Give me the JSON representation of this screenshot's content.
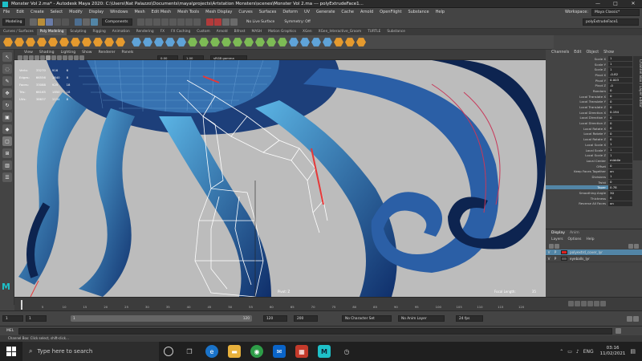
{
  "window": {
    "title": "Monster Vol 2.ma* - Autodesk Maya 2020: C:\\Users\\Nat Palazzo\\Documents\\maya\\projects\\Artstation Monsters\\scenes\\Monster Vol 2.ma  ---  polyExtrudeFace1...",
    "minimize": "—",
    "maximize": "□",
    "close": "✕"
  },
  "menubar": [
    "File",
    "Edit",
    "Create",
    "Select",
    "Modify",
    "Display",
    "Windows",
    "Mesh",
    "Edit Mesh",
    "Mesh Tools",
    "Mesh Display",
    "Curves",
    "Surfaces",
    "Deform",
    "UV",
    "Generate",
    "Cache",
    "Arnold",
    "OpenFlight",
    "Substance",
    "Help"
  ],
  "workspace": {
    "label": "Workspace:",
    "value": "Maya Classic*"
  },
  "statusline": {
    "mode": "Modeling",
    "components": "Components",
    "no_live_surface": "No Live Surface",
    "symmetry": "Symmetry: Off",
    "node_field": "polyExtrudeFace1"
  },
  "shelf_tabs": [
    "Curves / Surfaces",
    "Poly Modeling",
    "Sculpting",
    "Rigging",
    "Animation",
    "Rendering",
    "FX",
    "FX Caching",
    "Custom",
    "Arnold",
    "Bifrost",
    "MASH",
    "Motion Graphics",
    "XGen",
    "XGen_Interactive_Groom",
    "TURTLE",
    "Substance"
  ],
  "shelf_active": "Poly Modeling",
  "panel_menu": [
    "View",
    "Shading",
    "Lighting",
    "Show",
    "Renderer",
    "Panels"
  ],
  "panel_fields": {
    "a": "0.00",
    "b": "1.00",
    "colorspace": "sRGB gamma"
  },
  "hud": {
    "rows": [
      {
        "label": "Verts:",
        "a": "33270",
        "b": "916",
        "c": "6"
      },
      {
        "label": "Edges:",
        "a": "66556",
        "b": "1840",
        "c": "8"
      },
      {
        "label": "Faces:",
        "a": "33088",
        "b": "925",
        "c": "18"
      },
      {
        "label": "Tris:",
        "a": "66165",
        "b": "1850",
        "c": "18"
      },
      {
        "label": "UVs:",
        "a": "38637",
        "b": "1134",
        "c": "8"
      }
    ],
    "focal_length_label": "Focal Length:",
    "focal_length_value": "35",
    "pivot_label": "Pivot: Z"
  },
  "channelbox": {
    "tabs": [
      "Channels",
      "Edit",
      "Object",
      "Show"
    ],
    "rows": [
      {
        "name": "Scale X",
        "value": "1"
      },
      {
        "name": "Scale Y",
        "value": "1"
      },
      {
        "name": "Scale Z",
        "value": "1"
      },
      {
        "name": "Pivot X",
        "value": "-0.82"
      },
      {
        "name": "Pivot Y",
        "value": "0.003"
      },
      {
        "name": "Pivot Z",
        "value": "-0"
      },
      {
        "name": "Random",
        "value": "0"
      },
      {
        "name": "Local Translate X",
        "value": "0"
      },
      {
        "name": "Local Translate Y",
        "value": "0"
      },
      {
        "name": "Local Translate Z",
        "value": "0"
      },
      {
        "name": "Local Direction X",
        "value": "0.194"
      },
      {
        "name": "Local Direction Y",
        "value": "0"
      },
      {
        "name": "Local Direction Z",
        "value": "0"
      },
      {
        "name": "Local Rotate X",
        "value": "0"
      },
      {
        "name": "Local Rotate Y",
        "value": "0"
      },
      {
        "name": "Local Rotate Z",
        "value": "0"
      },
      {
        "name": "Local Scale X",
        "value": "1"
      },
      {
        "name": "Local Scale Y",
        "value": "1"
      },
      {
        "name": "Local Scale Z",
        "value": "1"
      },
      {
        "name": "Local Center",
        "value": "middle"
      },
      {
        "name": "Offset",
        "value": "0"
      },
      {
        "name": "Keep Faces Together",
        "value": "on"
      },
      {
        "name": "Divisions",
        "value": "1"
      },
      {
        "name": "Twist",
        "value": "0"
      },
      {
        "name": "Taper",
        "value": "0.78"
      },
      {
        "name": "Smoothing Angle",
        "value": "30"
      },
      {
        "name": "Thickness",
        "value": "0"
      },
      {
        "name": "Reverse All Faces",
        "value": "on"
      }
    ],
    "selected": "Taper",
    "side_tab": "Channel Box / Layer Editor"
  },
  "layers": {
    "tabs": [
      "Display",
      "Anim"
    ],
    "menu": [
      "Layers",
      "Options",
      "Help"
    ],
    "items": [
      {
        "v": "V",
        "p": "P",
        "name": "polyextrd_cover_lyr",
        "color": "#d22"
      },
      {
        "v": "V",
        "p": "P",
        "name": "eyeballs_lyr",
        "color": "#555"
      }
    ]
  },
  "timeline": {
    "ticks": [
      "1",
      "5",
      "10",
      "15",
      "20",
      "25",
      "30",
      "35",
      "40",
      "45",
      "50",
      "55",
      "60",
      "65",
      "70",
      "75",
      "80",
      "85",
      "90",
      "95",
      "100",
      "105",
      "110",
      "115",
      "120"
    ],
    "current_frame": "1"
  },
  "range": {
    "start": "1",
    "start2": "1",
    "slider_start": "1",
    "slider_end": "120",
    "end": "120",
    "end2": "200",
    "character_set": "No Character Set",
    "anim_layer": "No Anim Layer",
    "fps": "24 fps"
  },
  "mel": {
    "label": "MEL"
  },
  "help_line": "Channel Box: Click select, shift-click…",
  "taskbar": {
    "search_placeholder": "Type here to search",
    "lang": "ENG",
    "time": "03:16",
    "date": "11/02/2021"
  },
  "colors": {
    "accent": "#5285a6",
    "shelf_orange": "#e59a2e",
    "maya_logo": "#1ec0c8"
  }
}
